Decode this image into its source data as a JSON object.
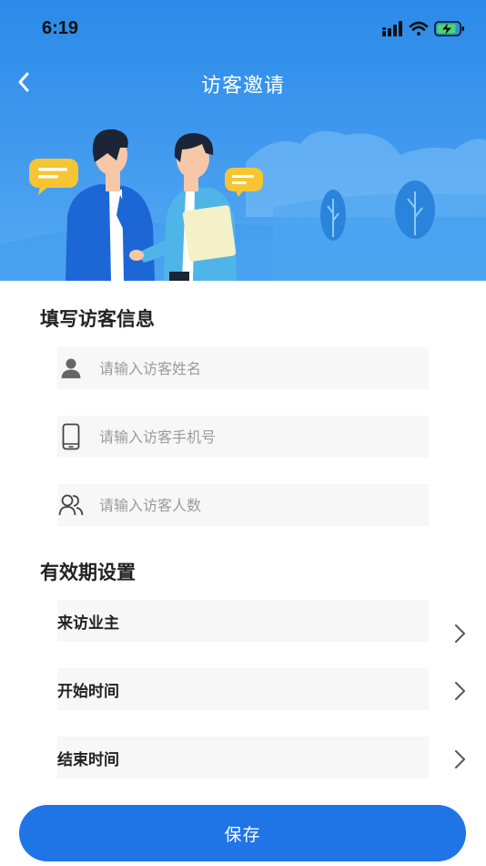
{
  "status_bar": {
    "time": "6:19",
    "icons": [
      "cellular-signal-icon",
      "wifi-icon",
      "battery-charging-icon"
    ]
  },
  "nav": {
    "title": "访客邀请",
    "back_icon": "chevron-left-icon"
  },
  "colors": {
    "banner_top": "#2b8be8",
    "banner_bottom": "#58aaf2",
    "primary_button": "#1f74e6",
    "field_background": "#f7f7f7",
    "placeholder": "#9b9b9b"
  },
  "visitor_info": {
    "title": "填写访客信息",
    "fields": [
      {
        "icon": "person-icon",
        "placeholder": "请输入访客姓名",
        "value": ""
      },
      {
        "icon": "mobile-phone-icon",
        "placeholder": "请输入访客手机号",
        "value": ""
      },
      {
        "icon": "people-group-icon",
        "placeholder": "请输入访客人数",
        "value": ""
      }
    ]
  },
  "validity": {
    "title": "有效期设置",
    "rows": [
      {
        "label": "来访业主",
        "icon": "chevron-right-icon"
      },
      {
        "label": "开始时间",
        "icon": "chevron-right-icon"
      },
      {
        "label": "结束时间",
        "icon": "chevron-right-icon"
      }
    ]
  },
  "save_label": "保存"
}
